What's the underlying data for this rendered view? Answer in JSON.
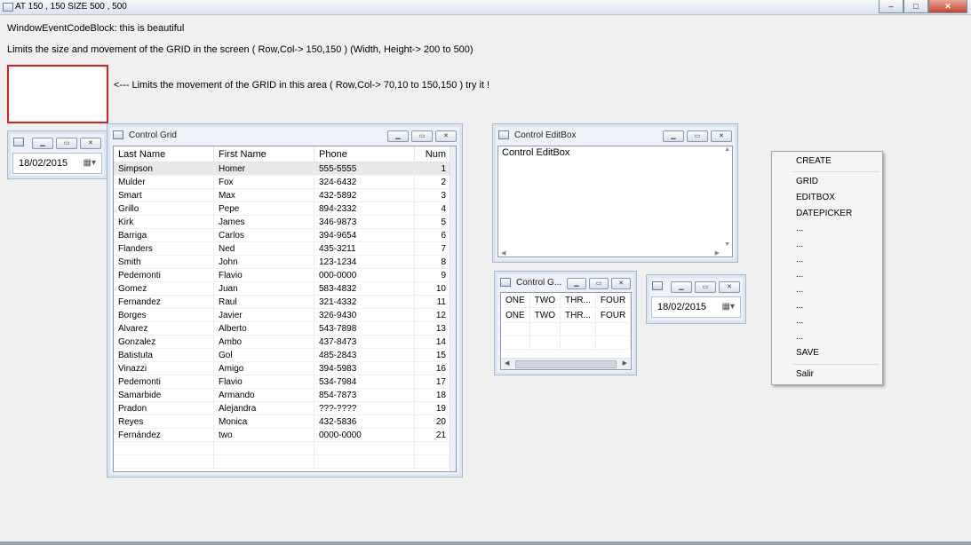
{
  "window": {
    "title": "AT 150 , 150 SIZE 500 , 500",
    "minimize": "–",
    "maximize": "□",
    "close": "✕"
  },
  "labels": {
    "line1": "WindowEventCodeBlock: this is beautiful",
    "line2": "Limits the size and movement of the GRID in the screen ( Row,Col-> 150,150 ) (Width, Height-> 200 to 500)",
    "line3": "<--- Limits the movement of the GRID in this area ( Row,Col-> 70,10 to 150,150 )  try it !"
  },
  "datepicker1": {
    "value": "18/02/2015"
  },
  "datepicker2": {
    "value": "18/02/2015"
  },
  "controlGrid": {
    "title": "Control Grid",
    "columns": [
      "Last Name",
      "First Name",
      "Phone",
      "Num"
    ],
    "rows": [
      [
        "Simpson",
        "Homer",
        "555-5555",
        "1"
      ],
      [
        "Mulder",
        "Fox",
        "324-6432",
        "2"
      ],
      [
        "Smart",
        "Max",
        "432-5892",
        "3"
      ],
      [
        "Grillo",
        "Pepe",
        "894-2332",
        "4"
      ],
      [
        "Kirk",
        "James",
        "346-9873",
        "5"
      ],
      [
        "Barriga",
        "Carlos",
        "394-9654",
        "6"
      ],
      [
        "Flanders",
        "Ned",
        "435-3211",
        "7"
      ],
      [
        "Smith",
        "John",
        "123-1234",
        "8"
      ],
      [
        "Pedemonti",
        "Flavio",
        "000-0000",
        "9"
      ],
      [
        "Gomez",
        "Juan",
        "583-4832",
        "10"
      ],
      [
        "Fernandez",
        "Raul",
        "321-4332",
        "11"
      ],
      [
        "Borges",
        "Javier",
        "326-9430",
        "12"
      ],
      [
        "Alvarez",
        "Alberto",
        "543-7898",
        "13"
      ],
      [
        "Gonzalez",
        "Ambo",
        "437-8473",
        "14"
      ],
      [
        "Batistuta",
        "Gol",
        "485-2843",
        "15"
      ],
      [
        "Vinazzi",
        "Amigo",
        "394-5983",
        "16"
      ],
      [
        "Pedemonti",
        "Flavio",
        "534-7984",
        "17"
      ],
      [
        "Samarbide",
        "Armando",
        "854-7873",
        "18"
      ],
      [
        "Pradon",
        "Alejandra",
        "???-????",
        "19"
      ],
      [
        "Reyes",
        "Monica",
        "432-5836",
        "20"
      ],
      [
        "Fernández",
        "two",
        "0000-0000",
        "21"
      ]
    ]
  },
  "editBox": {
    "title": "Control EditBox",
    "content": "Control EditBox"
  },
  "smallGrid": {
    "title": "Control G...",
    "rows": [
      [
        "ONE",
        "TWO",
        "THR...",
        "FOUR"
      ],
      [
        "ONE",
        "TWO",
        "THR...",
        "FOUR"
      ]
    ]
  },
  "menu": {
    "items": [
      "CREATE",
      "GRID",
      "EDITBOX",
      "DATEPICKER",
      "...",
      "...",
      "...",
      "...",
      "...",
      "...",
      "...",
      "...",
      "SAVE",
      "Salir"
    ]
  },
  "icons": {
    "window": "window-icon",
    "calendar": "calendar-icon"
  }
}
